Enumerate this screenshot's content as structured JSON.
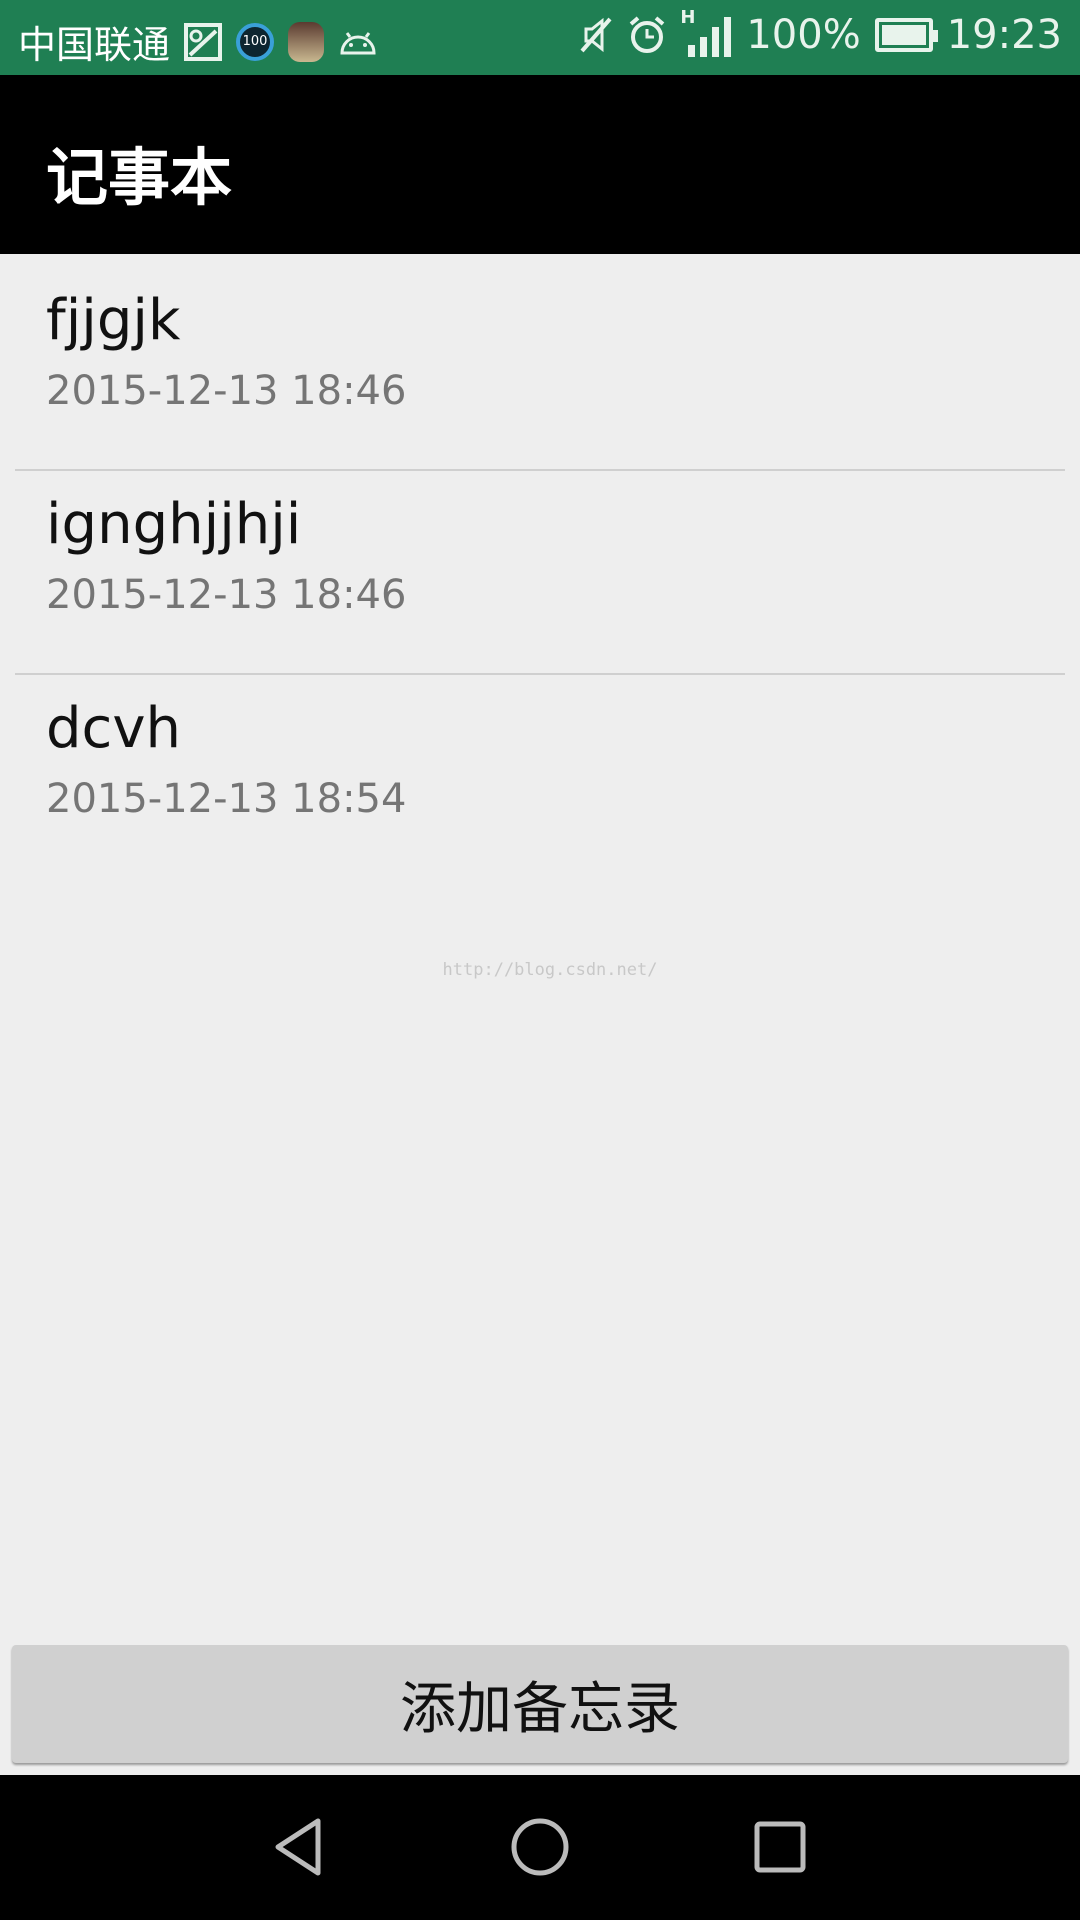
{
  "status_bar": {
    "carrier": "中国联通",
    "notification_badge": "100",
    "battery": "100%",
    "time": "19:23",
    "network": "H",
    "icons": [
      "gallery-icon",
      "badge-100-icon",
      "avatar-icon",
      "android-icon",
      "mute-icon",
      "alarm-icon",
      "signal-icon",
      "battery-icon"
    ]
  },
  "app_bar": {
    "title": "记事本"
  },
  "notes": [
    {
      "title": "fjjgjk",
      "date": "2015-12-13 18:46"
    },
    {
      "title": "ignghjjhji",
      "date": "2015-12-13 18:46"
    },
    {
      "title": "dcvh",
      "date": "2015-12-13 18:54"
    }
  ],
  "watermark": "http://blog.csdn.net/",
  "add_button": {
    "label": "添加备忘录"
  },
  "colors": {
    "status_bar": "#1f7f53",
    "app_bar": "#000000",
    "background": "#eeeeee",
    "button": "#d0d0d0"
  }
}
